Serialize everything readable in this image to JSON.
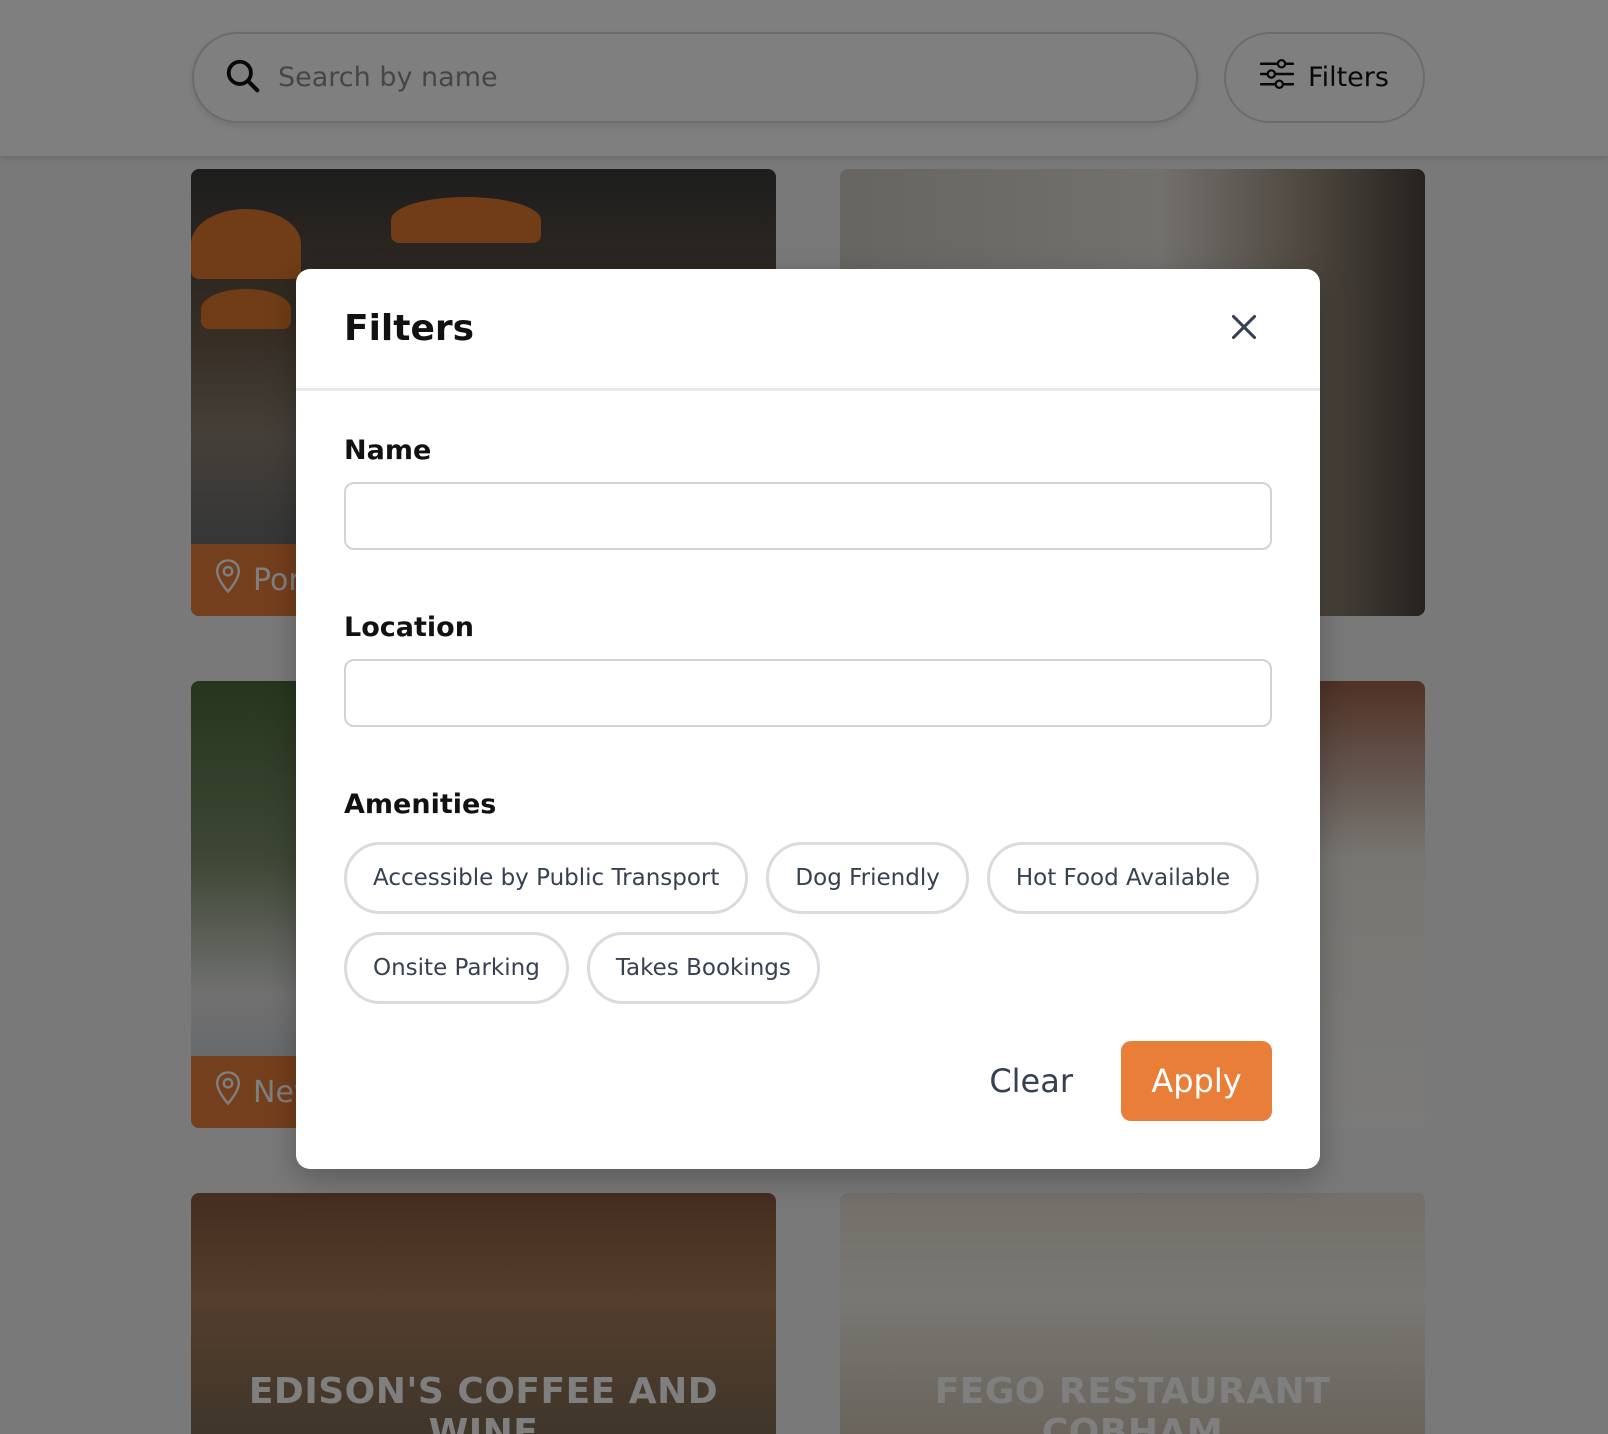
{
  "topbar": {
    "search_placeholder": "Search by name",
    "filters_label": "Filters"
  },
  "cards": [
    {
      "location": "Por",
      "title": ""
    },
    {
      "location": "",
      "title": ""
    },
    {
      "location": "Nev",
      "title": ""
    },
    {
      "location": "",
      "title": ""
    },
    {
      "location": "",
      "title": "EDISON'S COFFEE AND WINE"
    },
    {
      "location": "",
      "title": "FEGO RESTAURANT COBHAM"
    }
  ],
  "modal": {
    "title": "Filters",
    "name_label": "Name",
    "name_value": "",
    "location_label": "Location",
    "location_value": "",
    "amenities_label": "Amenities",
    "amenities": [
      "Accessible by Public Transport",
      "Dog Friendly",
      "Hot Food Available",
      "Onsite Parking",
      "Takes Bookings"
    ],
    "clear_label": "Clear",
    "apply_label": "Apply"
  },
  "colors": {
    "accent": "#e97e38",
    "overlay": "rgba(0,0,0,0.5)",
    "chip_border": "#d9dbe0"
  },
  "icons": [
    "search-icon",
    "sliders-icon",
    "close-icon",
    "map-pin-icon"
  ]
}
